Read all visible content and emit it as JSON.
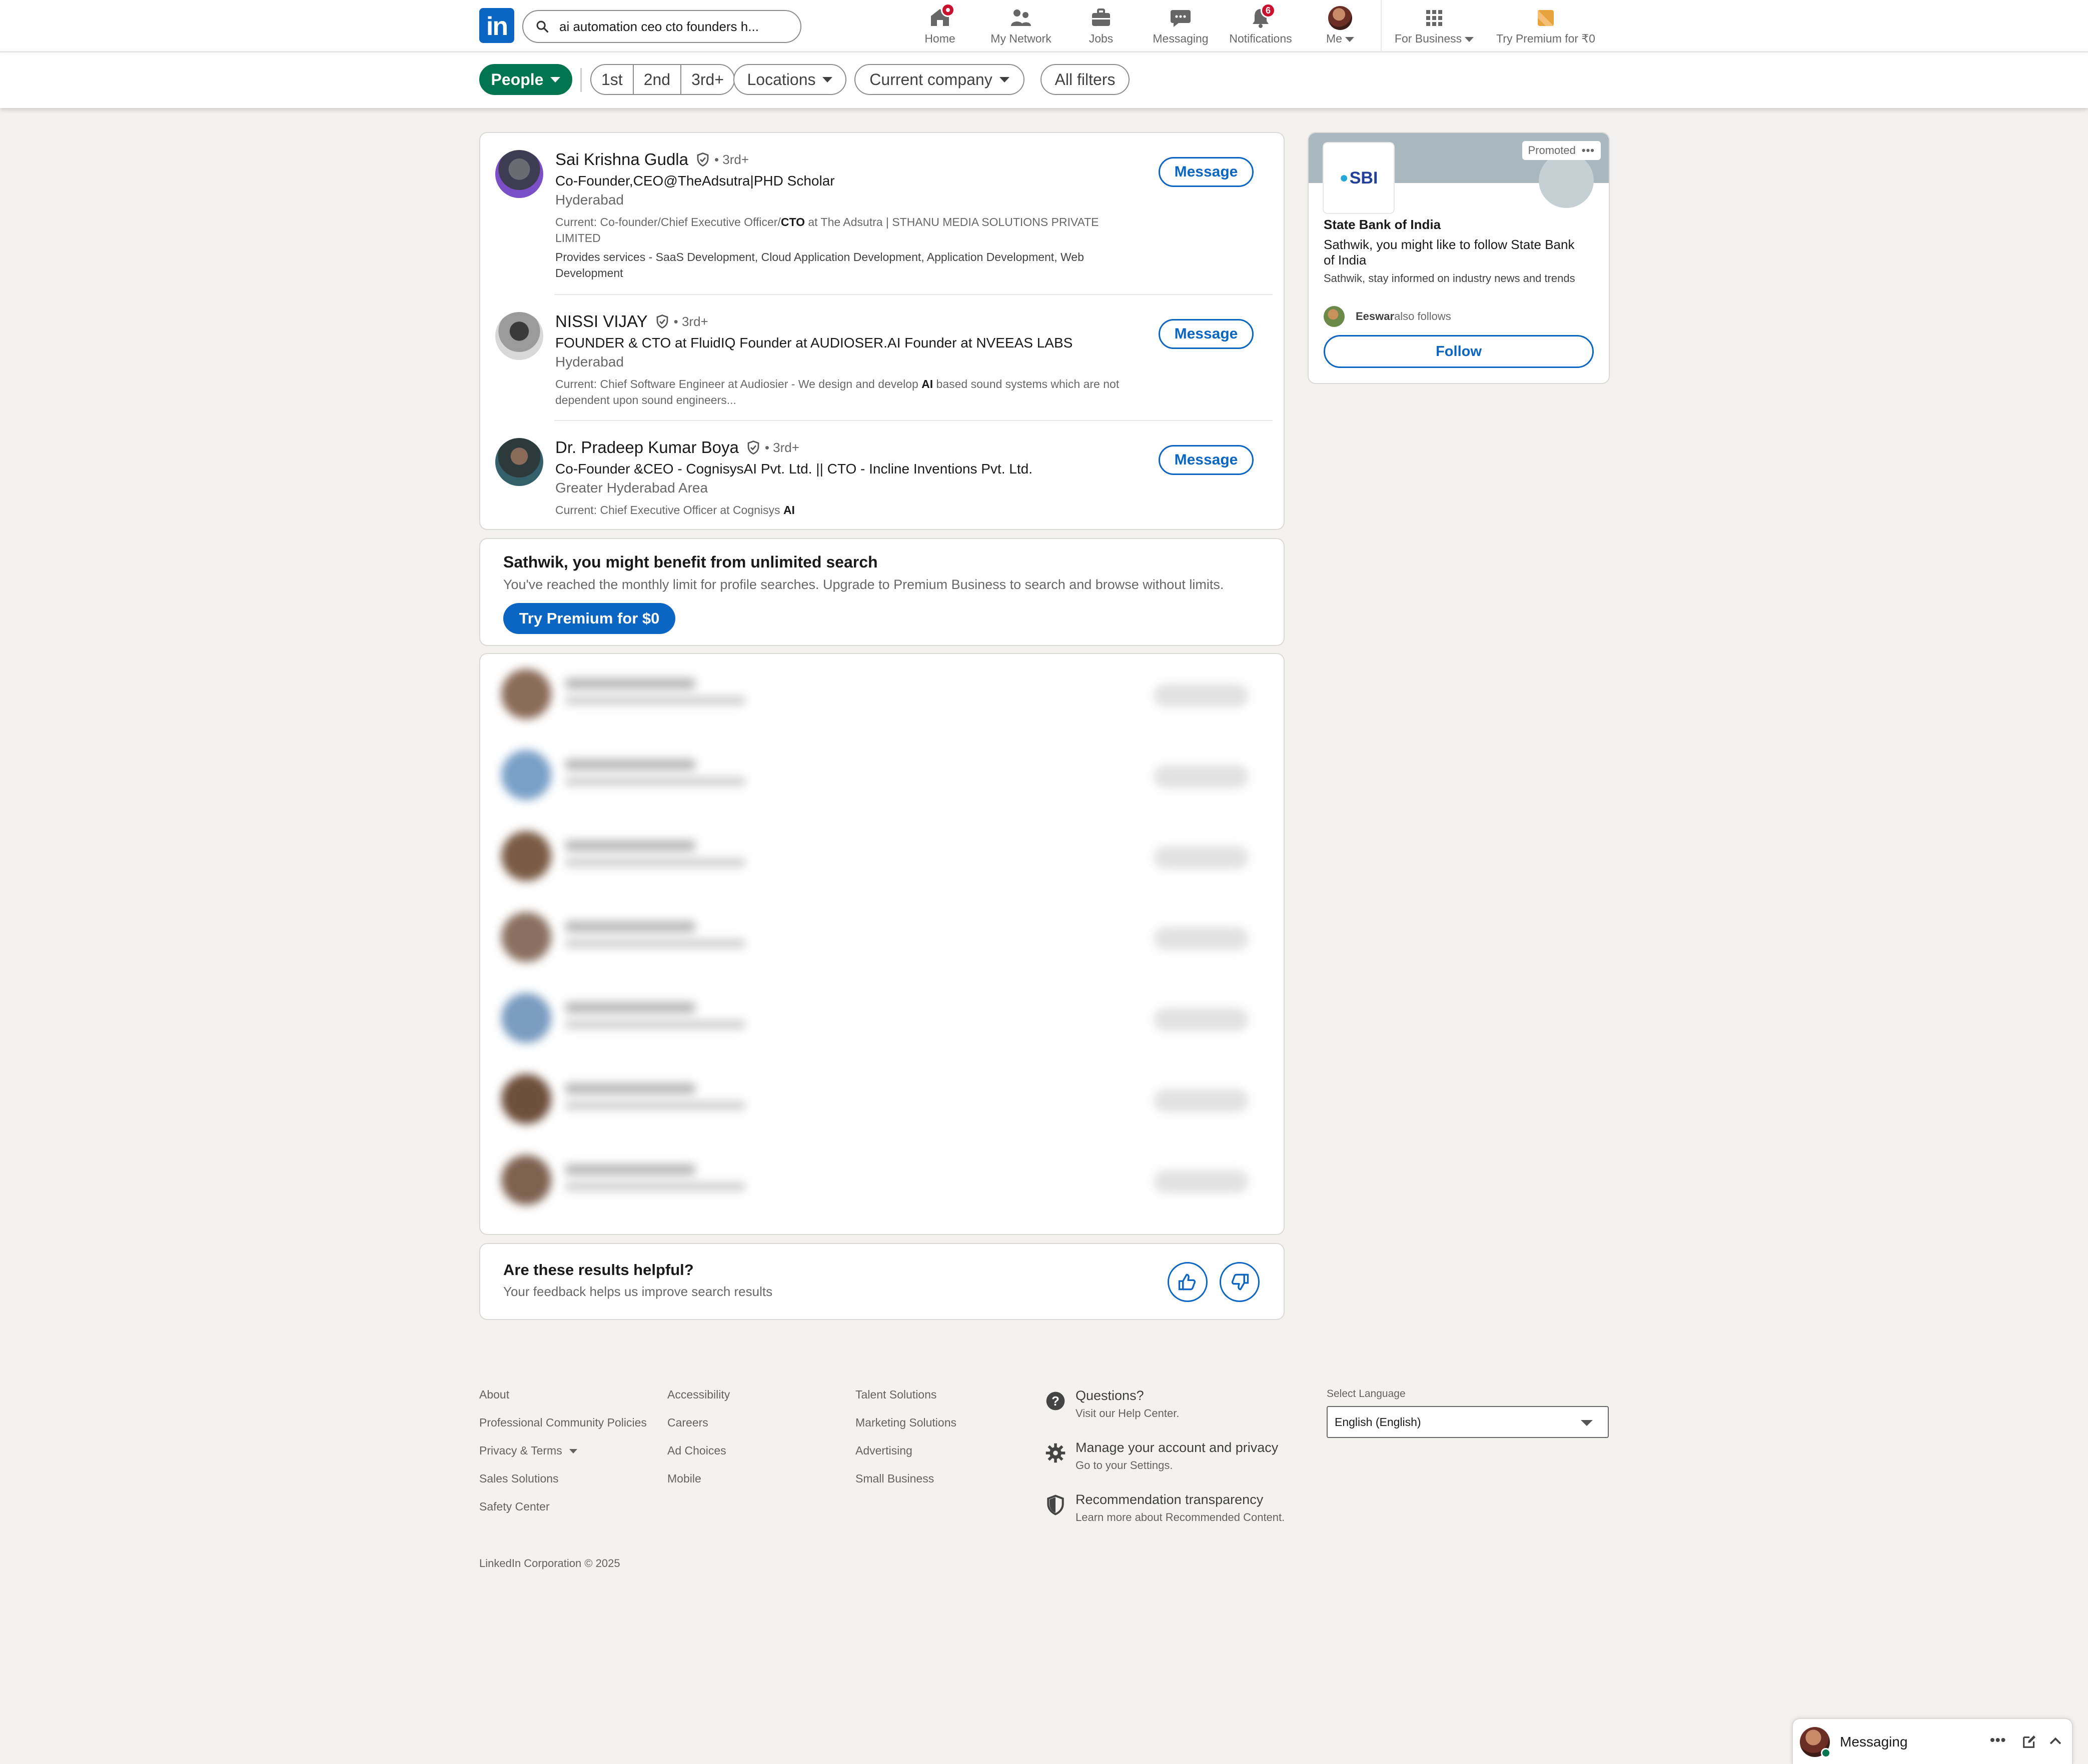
{
  "nav": {
    "logo": "in",
    "search_value": "ai automation ceo cto founders h...",
    "items": [
      {
        "label": "Home",
        "icon": "home-icon"
      },
      {
        "label": "My Network",
        "icon": "people-icon"
      },
      {
        "label": "Jobs",
        "icon": "briefcase-icon"
      },
      {
        "label": "Messaging",
        "icon": "chat-icon"
      },
      {
        "label": "Notifications",
        "icon": "bell-icon",
        "badge": "6"
      },
      {
        "label": "Me",
        "icon": "avatar"
      },
      {
        "label": "For Business",
        "icon": "grid-icon"
      },
      {
        "label": "Try Premium for ₹0",
        "icon": "premium-icon"
      }
    ]
  },
  "filters": {
    "people": "People",
    "degrees": [
      "1st",
      "2nd",
      "3rd+"
    ],
    "locations": "Locations",
    "current_company": "Current company",
    "all_filters": "All filters"
  },
  "results": [
    {
      "name": "Sai Krishna Gudla",
      "degree": "• 3rd+",
      "headline": "Co-Founder,CEO@TheAdsutra|PHD Scholar",
      "location": "Hyderabad",
      "current_prefix": "Current: Co-founder/Chief Executive Officer/",
      "current_highlight": "CTO",
      "current_suffix": " at The Adsutra | STHANU MEDIA SOLUTIONS PRIVATE LIMITED",
      "services": "Provides services - SaaS Development, Cloud Application Development, Application Development, Web Development",
      "button": "Message"
    },
    {
      "name": "NISSI VIJAY",
      "degree": "• 3rd+",
      "headline": "FOUNDER & CTO at FluidIQ Founder at AUDIOSER.AI Founder at NVEEAS LABS",
      "location": "Hyderabad",
      "current_prefix": "Current: Chief Software Engineer at Audiosier - We design and develop ",
      "current_highlight": "AI",
      "current_suffix": " based sound systems which are not dependent upon sound engineers...",
      "button": "Message"
    },
    {
      "name": "Dr. Pradeep Kumar Boya",
      "degree": "• 3rd+",
      "headline": "Co-Founder &CEO - CognisysAI Pvt. Ltd. || CTO - Incline Inventions Pvt. Ltd.",
      "location": "Greater Hyderabad Area",
      "current_prefix": "Current: Chief Executive Officer at Cognisys ",
      "current_highlight": "AI",
      "current_suffix": "",
      "button": "Message"
    }
  ],
  "upsell": {
    "title": "Sathwik, you might benefit from unlimited search",
    "text": "You've reached the monthly limit for profile searches. Upgrade to Premium Business to search and browse without limits.",
    "button": "Try Premium for $0"
  },
  "feedback": {
    "title": "Are these results helpful?",
    "subtitle": "Your feedback helps us improve search results"
  },
  "ad": {
    "promoted": "Promoted",
    "logo_text": "SBI",
    "company": "State Bank of India",
    "line1": "Sathwik, you might like to follow State Bank of India",
    "line2": "Sathwik, stay informed on industry news and trends",
    "follower_name": "Eeswar",
    "follower_text": " also follows",
    "button": "Follow"
  },
  "footer": {
    "col1": [
      "About",
      "Professional Community Policies",
      "Privacy & Terms",
      "Sales Solutions",
      "Safety Center"
    ],
    "col2": [
      "Accessibility",
      "Careers",
      "Ad Choices",
      "Mobile"
    ],
    "col3": [
      "Talent Solutions",
      "Marketing Solutions",
      "Advertising",
      "Small Business"
    ],
    "help": [
      {
        "title": "Questions?",
        "sub": "Visit our Help Center."
      },
      {
        "title": "Manage your account and privacy",
        "sub": "Go to your Settings."
      },
      {
        "title": "Recommendation transparency",
        "sub": "Learn more about Recommended Content."
      }
    ],
    "select_language_label": "Select Language",
    "language_value": "English (English)",
    "copyright": "LinkedIn Corporation © 2025"
  },
  "dock": {
    "label": "Messaging"
  },
  "colors": {
    "brand_blue": "#0a66c2",
    "people_green": "#01754f",
    "badge_red": "#cb112d",
    "page_bg": "#f4f2ee"
  }
}
